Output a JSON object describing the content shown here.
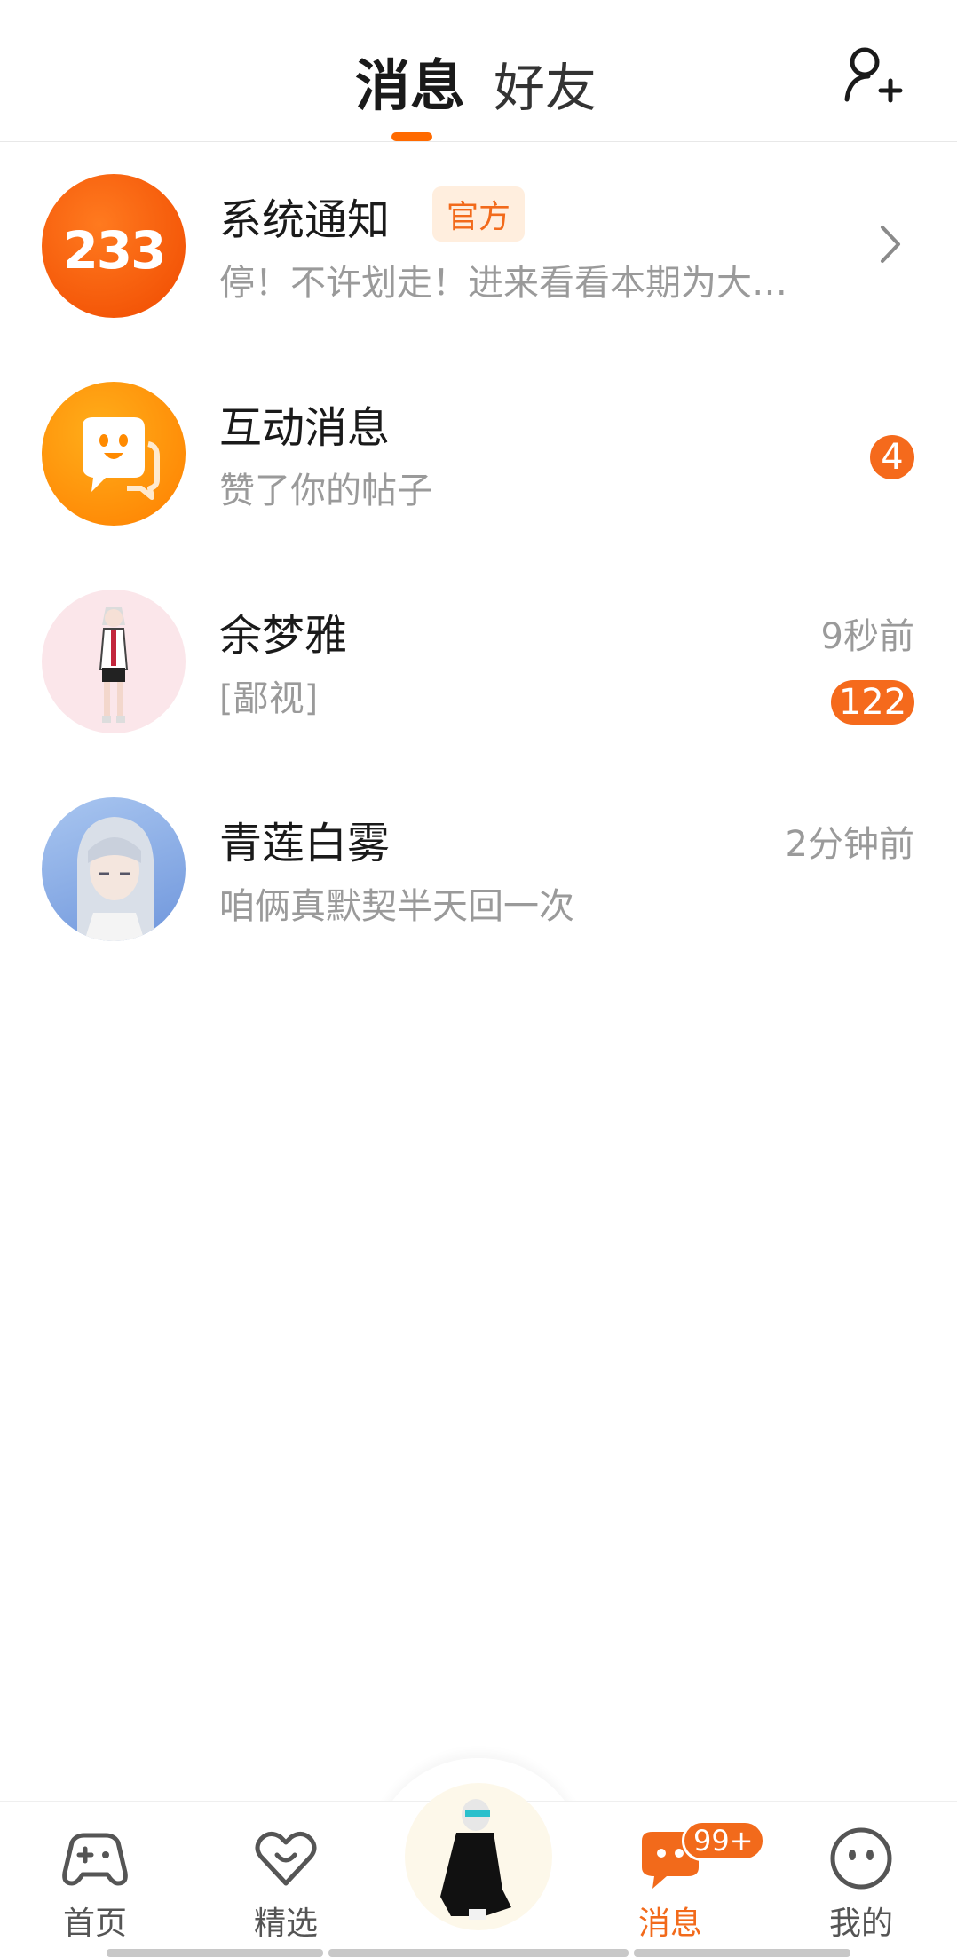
{
  "header": {
    "tab_active": "消息",
    "tab_inactive": "好友",
    "add_friend_icon": "add-user-icon"
  },
  "conversations": [
    {
      "title": "系统通知",
      "tag": "官方",
      "subtitle": "停！不许划走！进来看看本期为大…",
      "avatar_text": "233",
      "indicator": "chevron-right-icon"
    },
    {
      "title": "互动消息",
      "subtitle": "赞了你的帖子",
      "badge": "4",
      "avatar_icon": "chat-bubble-icon"
    },
    {
      "title": "余梦雅",
      "subtitle": "[鄙视]",
      "time": "9秒前",
      "badge": "122"
    },
    {
      "title": "青莲白雾",
      "subtitle": "咱俩真默契半天回一次",
      "time": "2分钟前"
    }
  ],
  "bottom_nav": {
    "items": [
      {
        "label": "首页",
        "icon": "gamepad-icon"
      },
      {
        "label": "精选",
        "icon": "heart-chat-icon"
      },
      {
        "label": "消息",
        "icon": "message-icon",
        "badge": "99+"
      },
      {
        "label": "我的",
        "icon": "smiley-icon"
      }
    ]
  },
  "colors": {
    "accent": "#f26a1b",
    "muted_text": "#9a9a9a"
  }
}
